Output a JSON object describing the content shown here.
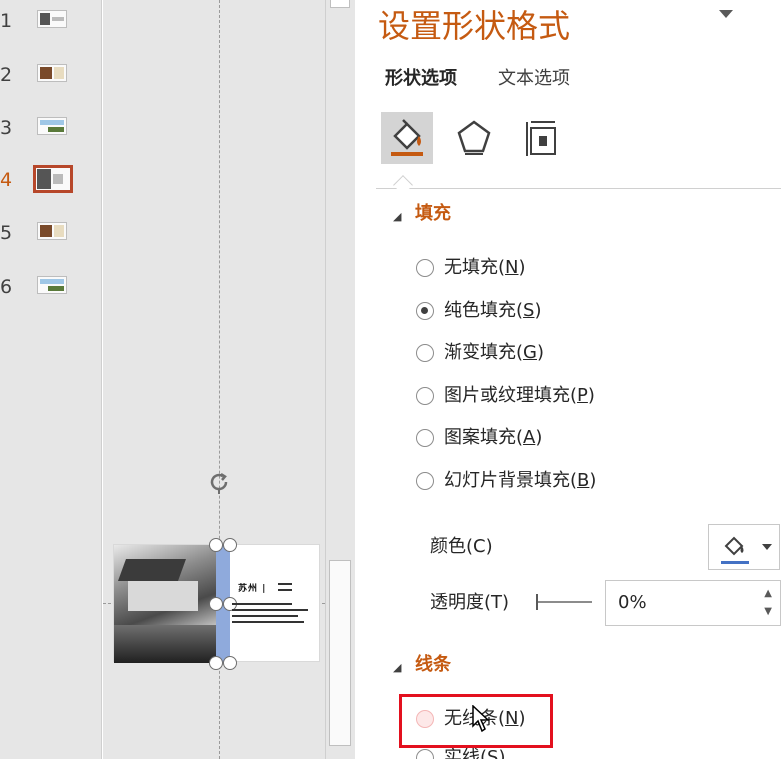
{
  "thumbnails": [
    {
      "number": "1",
      "active": false
    },
    {
      "number": "2",
      "active": false
    },
    {
      "number": "3",
      "active": false
    },
    {
      "number": "4",
      "active": true
    },
    {
      "number": "5",
      "active": false
    },
    {
      "number": "6",
      "active": false
    }
  ],
  "slide": {
    "title": "苏州 |"
  },
  "pane": {
    "title": "设置形状格式",
    "menu_icon": "dropdown-triangle-icon",
    "tabs": {
      "shape_options": "形状选项",
      "text_options": "文本选项"
    },
    "category_icons": [
      "fill-line-icon",
      "effects-pentagon-icon",
      "size-properties-icon"
    ]
  },
  "fill": {
    "toggle": "◢",
    "title": "填充",
    "options": [
      {
        "text": "无填充(",
        "key": "N",
        "end": ")",
        "checked": false
      },
      {
        "text": "纯色填充(",
        "key": "S",
        "end": ")",
        "checked": true
      },
      {
        "text": "渐变填充(",
        "key": "G",
        "end": ")",
        "checked": false
      },
      {
        "text": "图片或纹理填充(",
        "key": "P",
        "end": ")",
        "checked": false
      },
      {
        "text": "图案填充(",
        "key": "A",
        "end": ")",
        "checked": false
      },
      {
        "text": "幻灯片背景填充(",
        "key": "B",
        "end": ")",
        "checked": false
      }
    ],
    "color_label": "颜色(C)",
    "transparency_label": "透明度(T)",
    "transparency_value": "0%",
    "accent_color": "#4472c4"
  },
  "line": {
    "toggle": "◢",
    "title": "线条",
    "options": [
      {
        "text": "无线条(",
        "key": "N",
        "end": ")",
        "checked": false
      },
      {
        "text": "实线(",
        "key": "S",
        "end": ")",
        "checked": false
      }
    ]
  },
  "colors": {
    "accent": "#c55a11",
    "highlight": "#e3101e",
    "selection_bar": "#8faadc"
  }
}
